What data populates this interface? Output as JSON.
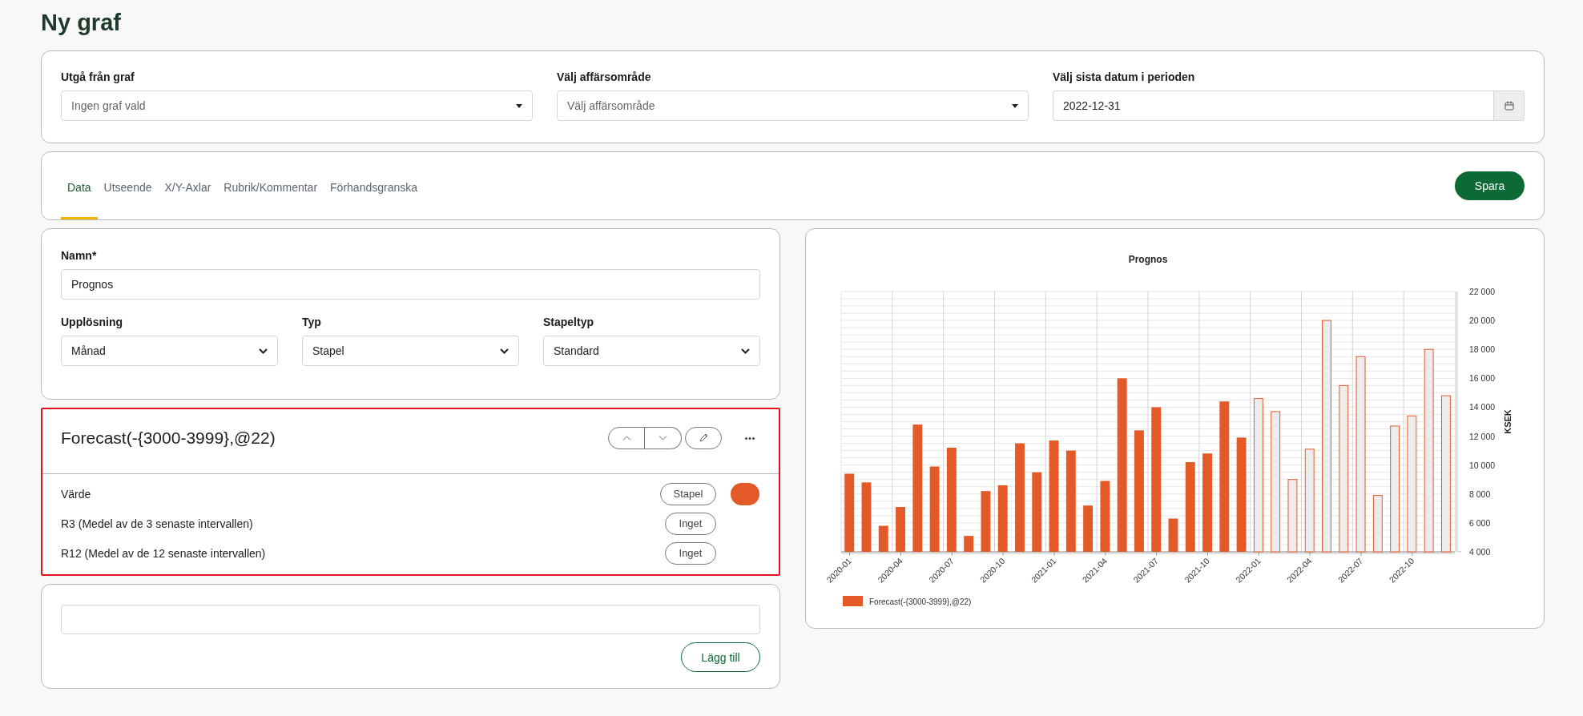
{
  "page_title": "Ny graf",
  "filters": [
    {
      "label": "Utgå från graf",
      "kind": "select",
      "placeholder": "Ingen graf vald"
    },
    {
      "label": "Välj affärsområde",
      "kind": "select",
      "placeholder": "Välj affärsområde"
    },
    {
      "label": "Välj sista datum i perioden",
      "kind": "date",
      "value": "2022-12-31"
    }
  ],
  "tabs": [
    {
      "label": "Data",
      "selected": true
    },
    {
      "label": "Utseende",
      "selected": false
    },
    {
      "label": "X/Y-Axlar",
      "selected": false
    },
    {
      "label": "Rubrik/Kommentar",
      "selected": false
    },
    {
      "label": "Förhandsgranska",
      "selected": false
    }
  ],
  "save_button": "Spara",
  "settings": {
    "name_label": "Namn*",
    "name_value": "Prognos",
    "selects": [
      {
        "label": "Upplösning",
        "value": "Månad"
      },
      {
        "label": "Typ",
        "value": "Stapel"
      },
      {
        "label": "Stapeltyp",
        "value": "Standard"
      }
    ]
  },
  "series_card": {
    "title": "Forecast(-{3000-3999},@22)",
    "highlighted": true,
    "rows": [
      {
        "label": "Värde",
        "type": "Stapel",
        "color": "#e35a28"
      },
      {
        "label": "R3 (Medel av de 3 senaste intervallen)",
        "type": "Inget"
      },
      {
        "label": "R12 (Medel av de 12 senaste intervallen)",
        "type": "Inget"
      }
    ]
  },
  "add_card": {
    "button": "Lägg till"
  },
  "chart": {
    "chart_data": {
      "type": "bar",
      "title": "Prognos",
      "ylabel": "KSEK",
      "grid": true,
      "categories": [
        "2020-01",
        null,
        null,
        "2020-04",
        null,
        null,
        "2020-07",
        null,
        null,
        "2020-10",
        null,
        null,
        "2021-01",
        null,
        null,
        "2021-04",
        null,
        null,
        "2021-07",
        null,
        null,
        "2021-10",
        null,
        null,
        "2022-01",
        null,
        null,
        "2022-04",
        null,
        null,
        "2022-07",
        null,
        null,
        "2022-10",
        null,
        null
      ],
      "series": [
        {
          "name": "Forecast(-{3000-3999},@22)",
          "color": "#e35a28",
          "values": [
            9400,
            8800,
            5800,
            7100,
            12800,
            9900,
            11200,
            5100,
            8200,
            8600,
            11500,
            9500,
            11700,
            11000,
            7200,
            8900,
            16000,
            12400,
            14000,
            6300,
            10200,
            10800,
            14400,
            11900,
            null,
            null,
            null,
            null,
            null,
            null,
            null,
            null,
            null,
            null,
            null,
            null
          ]
        },
        {
          "color": "#ececec",
          "values": [
            null,
            null,
            null,
            null,
            null,
            null,
            null,
            null,
            null,
            null,
            null,
            null,
            null,
            null,
            null,
            null,
            null,
            null,
            null,
            null,
            null,
            null,
            null,
            null,
            14600,
            13700,
            9000,
            11100,
            20000,
            15500,
            17500,
            7900,
            12700,
            13400,
            18000,
            14800
          ]
        }
      ],
      "ylim": [
        4000,
        22000
      ],
      "yticks": [
        {
          "value": 4000,
          "label": "4 000"
        },
        {
          "value": 6000,
          "label": "6 000"
        },
        {
          "value": 8000,
          "label": "8 000"
        },
        {
          "value": 10000,
          "label": "10 000"
        },
        {
          "value": 12000,
          "label": "12 000"
        },
        {
          "value": 14000,
          "label": "14 000"
        },
        {
          "value": 16000,
          "label": "16 000"
        },
        {
          "value": 18000,
          "label": "18 000"
        },
        {
          "value": 20000,
          "label": "20 000"
        },
        {
          "value": 22000,
          "label": "22 000"
        }
      ]
    }
  }
}
